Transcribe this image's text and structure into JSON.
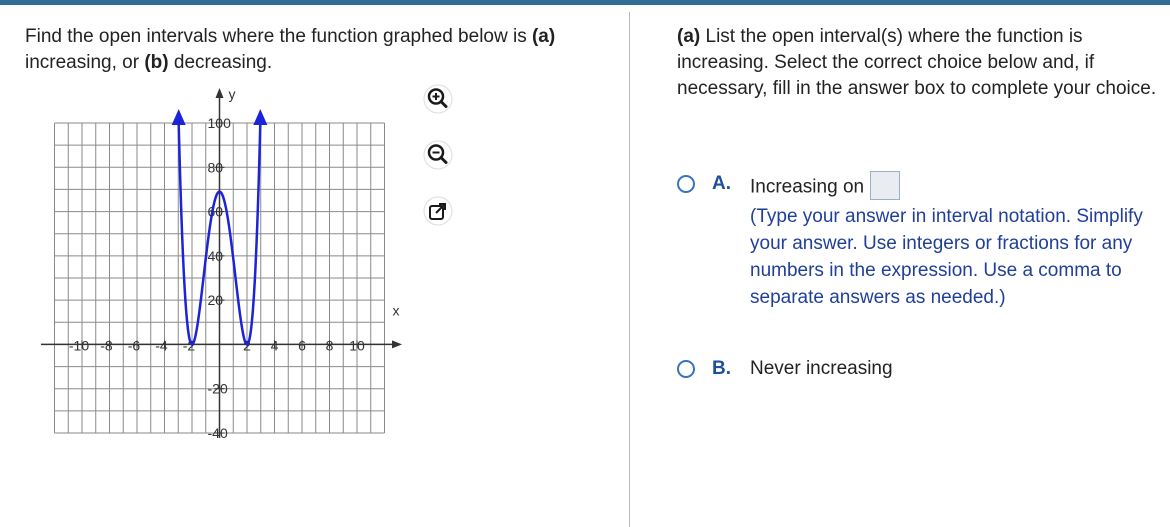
{
  "left": {
    "prompt_parts": {
      "p1": "Find the open intervals where the function graphed below is ",
      "a": "(a)",
      "p2": " increasing, or ",
      "b": "(b)",
      "p3": " decreasing."
    },
    "tools": [
      "zoom-in-icon",
      "zoom-out-icon",
      "open-external-icon"
    ]
  },
  "graph": {
    "axis_label_x": "x",
    "axis_label_y": "y",
    "x_ticks": [
      "-10",
      "-8",
      "-6",
      "-4",
      "-2",
      "2",
      "4",
      "6",
      "8",
      "10"
    ],
    "y_ticks": [
      "100",
      "80",
      "60",
      "40",
      "20",
      "-20",
      "-40"
    ],
    "curve_color": "#1b24d6",
    "xlim": [
      -10,
      10
    ],
    "ylim": [
      -40,
      100
    ],
    "key_points": [
      {
        "x": -3.6,
        "y": 100
      },
      {
        "x": -2,
        "y": 0
      },
      {
        "x": 0,
        "y": 69
      },
      {
        "x": 2,
        "y": 0
      },
      {
        "x": 3.6,
        "y": 100
      }
    ]
  },
  "right": {
    "question_parts": {
      "a": "(a)",
      "rest": " List the open interval(s) where the function is increasing. Select the correct choice below and, if necessary, fill in the answer box to complete your choice."
    },
    "choices": [
      {
        "letter": "A.",
        "text": "Increasing on",
        "selected": false
      },
      {
        "letter": "B.",
        "text": "Never increasing",
        "selected": false
      }
    ],
    "hint": "(Type your answer in interval notation. Simplify your answer. Use integers or fractions for any numbers in the expression. Use a comma to separate answers as needed.)"
  },
  "colors": {
    "accent": "#2f6d95",
    "choice_letter": "#1f4fa0",
    "hint": "#1f3f99",
    "grid": "#8a8a8a"
  }
}
